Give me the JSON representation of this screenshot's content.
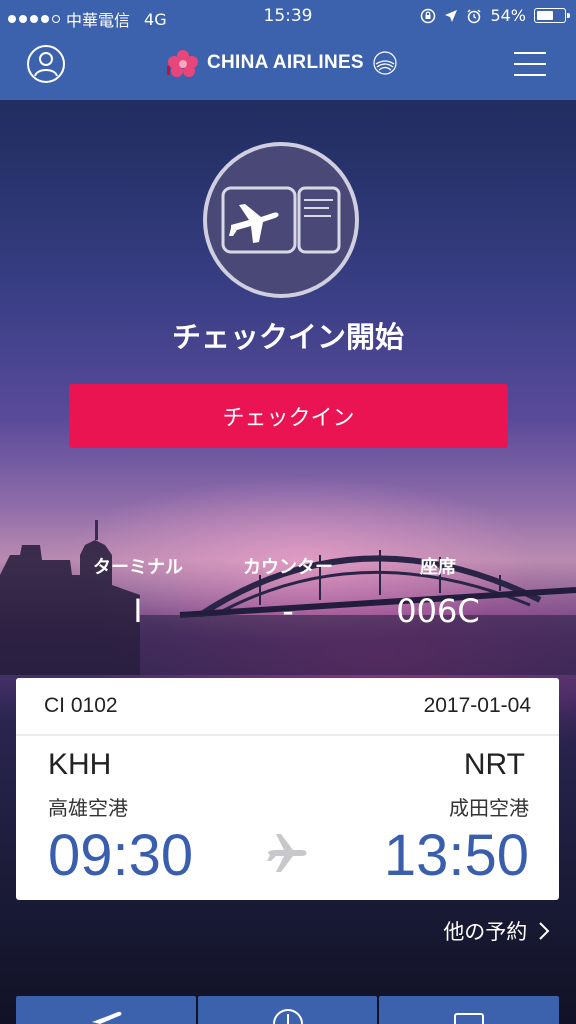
{
  "status_bar": {
    "carrier": "中華電信",
    "network": "4G",
    "time": "15:39",
    "battery": "54%"
  },
  "header": {
    "logo_text": "CHINA AIRLINES",
    "brand_color": "#3d62ad"
  },
  "checkin": {
    "title": "チェックイン開始",
    "button_label": "チェックイン",
    "button_color": "#ea1452"
  },
  "info": {
    "terminal_label": "ターミナル",
    "terminal_value": "I",
    "counter_label": "カウンター",
    "counter_value": "-",
    "seat_label": "座席",
    "seat_value": "006C"
  },
  "flight": {
    "number": "CI 0102",
    "date": "2017-01-04",
    "origin_code": "KHH",
    "origin_name": "高雄空港",
    "departure_time": "09:30",
    "destination_code": "NRT",
    "destination_name": "成田空港",
    "arrival_time": "13:50"
  },
  "other_reservations": "他の予約",
  "icons": {
    "profile": "profile-icon",
    "menu": "menu-icon",
    "boarding_pass": "boarding-pass-icon",
    "plane": "plane-icon",
    "chevron": "chevron-right-icon"
  }
}
